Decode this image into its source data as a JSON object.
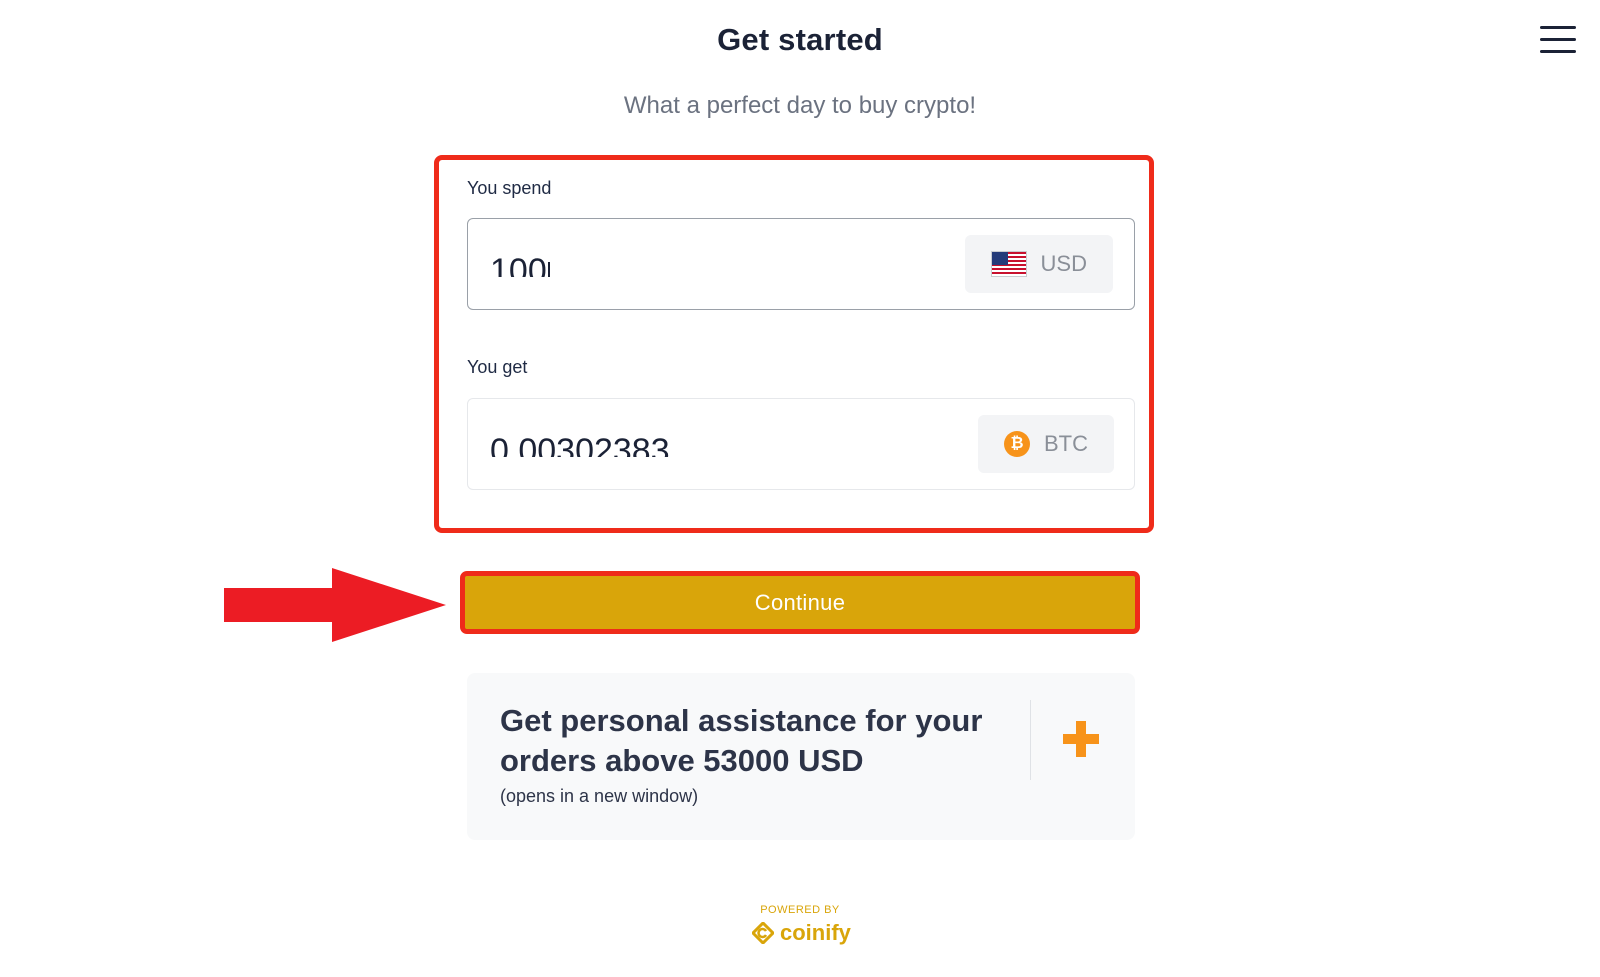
{
  "header": {
    "title": "Get started",
    "subtitle": "What a perfect day to buy crypto!",
    "menu_icon": "hamburger-menu-icon"
  },
  "spend": {
    "label": "You spend",
    "value": "100",
    "currency": "USD",
    "currency_icon": "us-flag-icon"
  },
  "get": {
    "label": "You get",
    "value": "0.00302383",
    "currency": "BTC",
    "currency_icon": "bitcoin-icon"
  },
  "actions": {
    "continue_label": "Continue"
  },
  "assistance": {
    "heading": "Get personal assistance for your orders above 53000 USD",
    "note": "(opens in a new window)",
    "icon": "plus-icon"
  },
  "footer": {
    "powered_by": "POWERED BY",
    "brand": "coinify"
  },
  "colors": {
    "accent": "#d9a50a",
    "highlight": "#ef2b1a",
    "bitcoin": "#f7931a",
    "text": "#1b2236"
  }
}
